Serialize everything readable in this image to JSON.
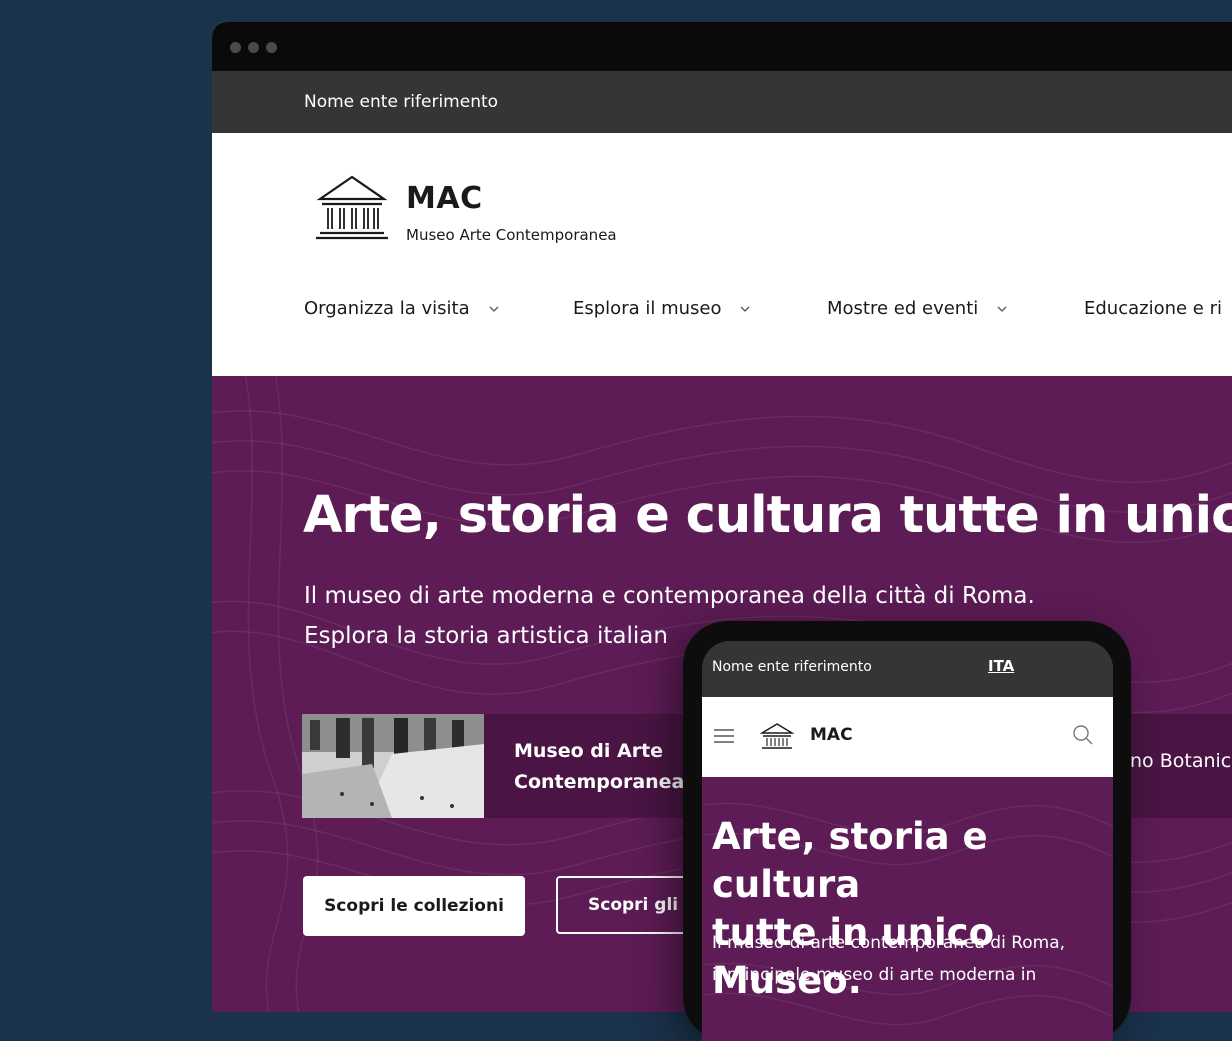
{
  "site": {
    "ente": "Nome ente riferimento",
    "brand_name": "MAC",
    "brand_sub": "Museo Arte Contemporanea"
  },
  "nav": {
    "items": [
      {
        "label": "Organizza la visita"
      },
      {
        "label": "Esplora il museo"
      },
      {
        "label": "Mostre ed eventi"
      },
      {
        "label": "Educazione e ri"
      }
    ]
  },
  "hero": {
    "title": "Arte, storia e cultura tutte in unico Mus",
    "subtitle_line1": "Il museo di arte moderna e contemporanea della città di Roma.",
    "subtitle_line2": "Esplora la storia artistica italian"
  },
  "cards": [
    {
      "line1": "Museo di Arte",
      "line2": "Contemporanea"
    },
    {
      "label": "no Botanic"
    }
  ],
  "buttons": {
    "primary": "Scopri le collezioni",
    "secondary": "Scopri gli a"
  },
  "mobile": {
    "ente": "Nome ente riferimento",
    "lang": "ITA",
    "brand_name": "MAC",
    "title_line1": "Arte, storia e cultura",
    "title_line2": "tutte in unico Museo.",
    "sub_line1": "Il museo di arte contemporanea di Roma,",
    "sub_line2": "il principale museo di arte moderna in"
  },
  "colors": {
    "background": "#1b324b",
    "hero": "#5d1c56",
    "topbar": "#353535"
  }
}
